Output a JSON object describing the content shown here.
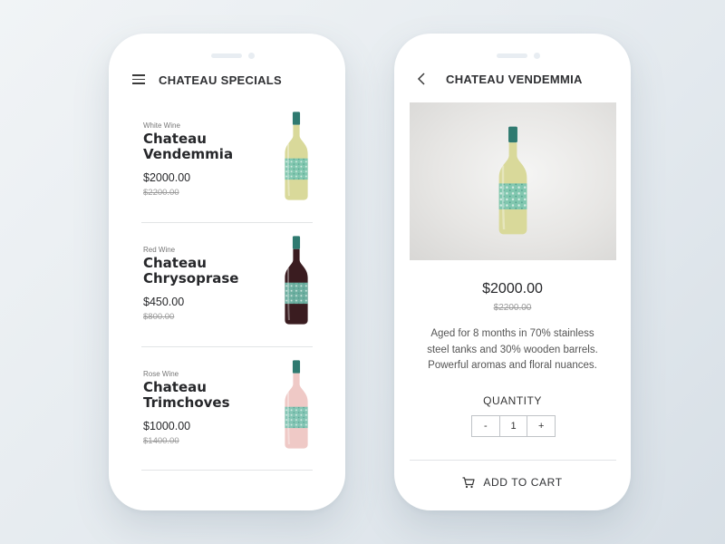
{
  "colors": {
    "white_wine": "#d9d99a",
    "red_wine": "#3a1c20",
    "rose_wine": "#efc9c6",
    "label_teal": "#74c4b2",
    "cap_teal": "#2f7a70"
  },
  "list_screen": {
    "title": "CHATEAU SPECIALS",
    "menu_icon": "hamburger-menu-icon",
    "items": [
      {
        "category": "White Wine",
        "name": "Chateau Vendemmia",
        "price": "$2000.00",
        "old_price": "$2200.00",
        "bottle_color": "#d9d99a"
      },
      {
        "category": "Red Wine",
        "name": "Chateau Chrysoprase",
        "price": "$450.00",
        "old_price": "$800.00",
        "bottle_color": "#3a1c20"
      },
      {
        "category": "Rose Wine",
        "name": "Chateau Trimchoves",
        "price": "$1000.00",
        "old_price": "$1400.00",
        "bottle_color": "#efc9c6"
      }
    ]
  },
  "detail_screen": {
    "back_icon": "chevron-left-icon",
    "title": "CHATEAU VENDEMMIA",
    "price": "$2000.00",
    "old_price": "$2200.00",
    "description": "Aged for 8 months in 70% stainless steel tanks and 30% wooden barrels. Powerful aromas and floral nuances.",
    "quantity_label": "QUANTITY",
    "quantity": {
      "decrement_label": "-",
      "value": "1",
      "increment_label": "+"
    },
    "cart_icon": "shopping-cart-icon",
    "add_to_cart_label": "ADD TO CART"
  }
}
